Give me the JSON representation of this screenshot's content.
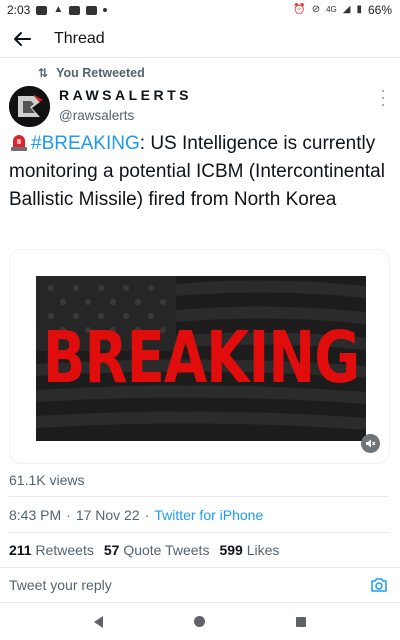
{
  "status_bar": {
    "time": "2:03",
    "battery": "66%",
    "network": "4G"
  },
  "header": {
    "title": "Thread"
  },
  "tweet": {
    "retweeted_label": "You Retweeted",
    "author_name": "RAWSALERTS",
    "author_handle": "@rawsalerts",
    "text_hashtag": "#BREAKING",
    "text_body": ": US Intelligence is currently monitoring a potential ICBM (Intercontinental Ballistic Missile) fired from North Korea",
    "media_text": "BREAKING",
    "views": "61.1K views",
    "time": "8:43 PM",
    "date": "17 Nov 22",
    "source": "Twitter for iPhone",
    "retweets_count": "211",
    "retweets_label": "Retweets",
    "quotes_count": "57",
    "quotes_label": "Quote Tweets",
    "likes_count": "599",
    "likes_label": "Likes"
  },
  "reply": {
    "placeholder": "Tweet your reply"
  },
  "colors": {
    "accent": "#1d9bf0",
    "secondary_text": "#536471",
    "breaking_red": "#e10d0d"
  }
}
